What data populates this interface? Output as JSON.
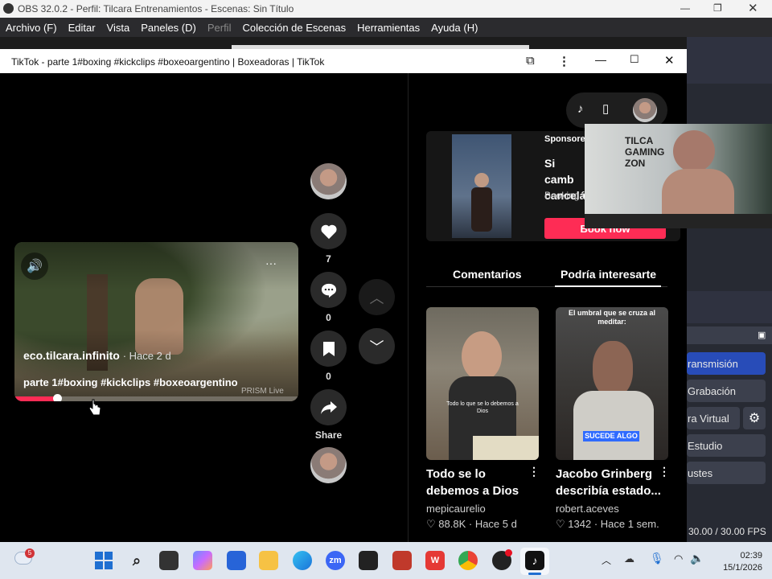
{
  "obs": {
    "window_title": "OBS 32.0.2 - Perfil: Tilcara Entrenamientos - Escenas: Sin Título",
    "menu": [
      "Archivo (F)",
      "Editar",
      "Vista",
      "Paneles (D)",
      "Perfil",
      "Colección de Escenas",
      "Herramientas",
      "Ayuda (H)"
    ],
    "dock_buttons": [
      "ransmisión",
      "Grabación",
      "ra Virtual",
      "Estudio",
      "ustes"
    ],
    "fps": "30.00 / 30.00 FPS"
  },
  "browser": {
    "tab_title": "TikTok - parte 1#boxing #kickclips #boxeoargentino | Boxeadoras | TikTok"
  },
  "video": {
    "author": "eco.tilcara.infinito",
    "time": "· Hace 2 d",
    "caption": "parte 1#boxing #kickclips #boxeoargentino",
    "watermark": "PRISM Live",
    "progress": 0.15
  },
  "actions": {
    "likes": "7",
    "comments": "0",
    "saves": "0",
    "share_label": "Share"
  },
  "ad": {
    "sponsored": "Sponsored",
    "headline": "Si camb cancelá",
    "domain": "Booking.c",
    "cta": "Book now"
  },
  "webcam": {
    "sign": "TILCA GAMING ZON"
  },
  "tabs": {
    "comments": "Comentarios",
    "related": "Podría interesarte"
  },
  "cards": [
    {
      "title": "Todo se lo debemos a Dios",
      "author": "mepicaurelio",
      "likes": "♡ 88.8K",
      "time": "· Hace 5 d",
      "overlay": "Todo lo que se lo debemos a Dios"
    },
    {
      "title": "Jacobo Grinberg describía estado...",
      "author": "robert.aceves",
      "likes": "♡ 1342",
      "time": "· Hace 1 sem.",
      "overlay_top": "El umbral que se cruza al meditar:",
      "overlay_bottom": "SUCEDE ALGO"
    }
  ],
  "taskbar": {
    "weather_badge": "5",
    "time": "02:39",
    "date": "15/1/2026"
  },
  "colors": {
    "tiktok_red": "#fe2c55",
    "obs_blue": "#284cb8",
    "obs_bg": "#272a33"
  }
}
